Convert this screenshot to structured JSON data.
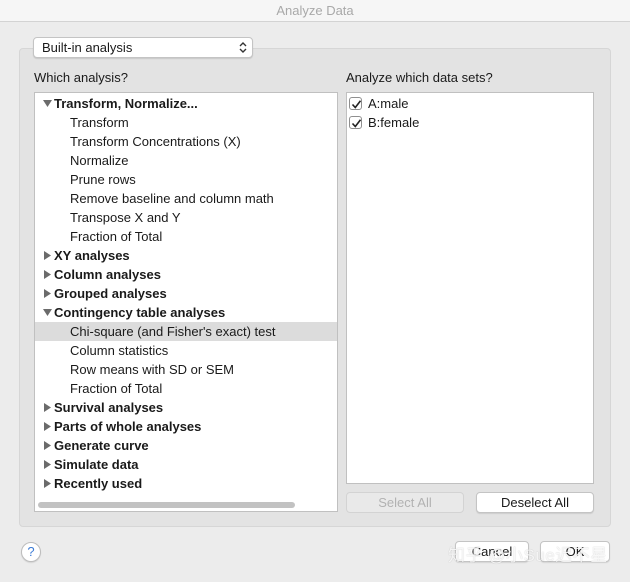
{
  "window": {
    "title": "Analyze Data"
  },
  "analysis_popup": {
    "value": "Built-in analysis"
  },
  "left_panel": {
    "label": "Which analysis?",
    "rows": [
      {
        "text": "Transform, Normalize...",
        "type": "group",
        "expanded": true
      },
      {
        "text": "Transform",
        "type": "item"
      },
      {
        "text": "Transform Concentrations (X)",
        "type": "item"
      },
      {
        "text": "Normalize",
        "type": "item"
      },
      {
        "text": "Prune rows",
        "type": "item"
      },
      {
        "text": "Remove baseline and column math",
        "type": "item"
      },
      {
        "text": "Transpose X and Y",
        "type": "item"
      },
      {
        "text": "Fraction of Total",
        "type": "item"
      },
      {
        "text": "XY analyses",
        "type": "group",
        "expanded": false
      },
      {
        "text": "Column analyses",
        "type": "group",
        "expanded": false
      },
      {
        "text": "Grouped analyses",
        "type": "group",
        "expanded": false
      },
      {
        "text": "Contingency table analyses",
        "type": "group",
        "expanded": true
      },
      {
        "text": "Chi-square (and Fisher's exact) test",
        "type": "item",
        "selected": true
      },
      {
        "text": "Column statistics",
        "type": "item"
      },
      {
        "text": "Row means with SD or SEM",
        "type": "item"
      },
      {
        "text": "Fraction of Total",
        "type": "item"
      },
      {
        "text": "Survival analyses",
        "type": "group",
        "expanded": false
      },
      {
        "text": "Parts of whole analyses",
        "type": "group",
        "expanded": false
      },
      {
        "text": "Generate curve",
        "type": "group",
        "expanded": false
      },
      {
        "text": "Simulate data",
        "type": "group",
        "expanded": false
      },
      {
        "text": "Recently used",
        "type": "group",
        "expanded": false
      }
    ]
  },
  "right_panel": {
    "label": "Analyze which data sets?",
    "datasets": [
      {
        "text": "A:male",
        "checked": true
      },
      {
        "text": "B:female",
        "checked": true
      }
    ],
    "select_all_label": "Select All",
    "deselect_all_label": "Deselect All"
  },
  "footer": {
    "help_label": "?",
    "cancel_label": "Cancel",
    "ok_label": "OK",
    "watermark": "知乎 @小Sue迟不星"
  },
  "colors": {
    "selection": "#dcdcdc",
    "help_accent": "#3c7bd6"
  }
}
